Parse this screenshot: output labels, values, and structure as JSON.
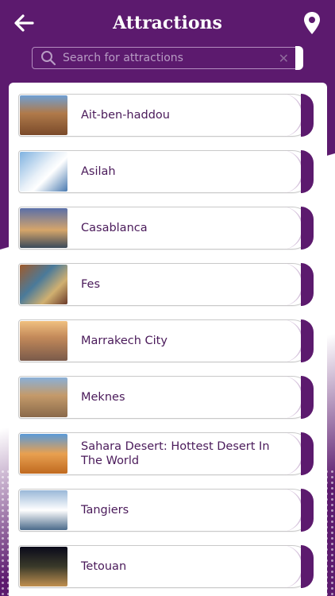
{
  "header": {
    "title": "Attractions",
    "back_icon": "arrow-left-icon",
    "location_icon": "map-pin-icon"
  },
  "search": {
    "placeholder": "Search for attractions",
    "value": ""
  },
  "attractions": [
    {
      "label": "Ait-ben-haddou"
    },
    {
      "label": "Asilah"
    },
    {
      "label": "Casablanca"
    },
    {
      "label": "Fes"
    },
    {
      "label": "Marrakech City"
    },
    {
      "label": "Meknes"
    },
    {
      "label": "Sahara Desert: Hottest Desert In The World"
    },
    {
      "label": "Tangiers"
    },
    {
      "label": "Tetouan"
    }
  ],
  "colors": {
    "brand": "#5c1a6e",
    "text": "#4a1a5a"
  }
}
